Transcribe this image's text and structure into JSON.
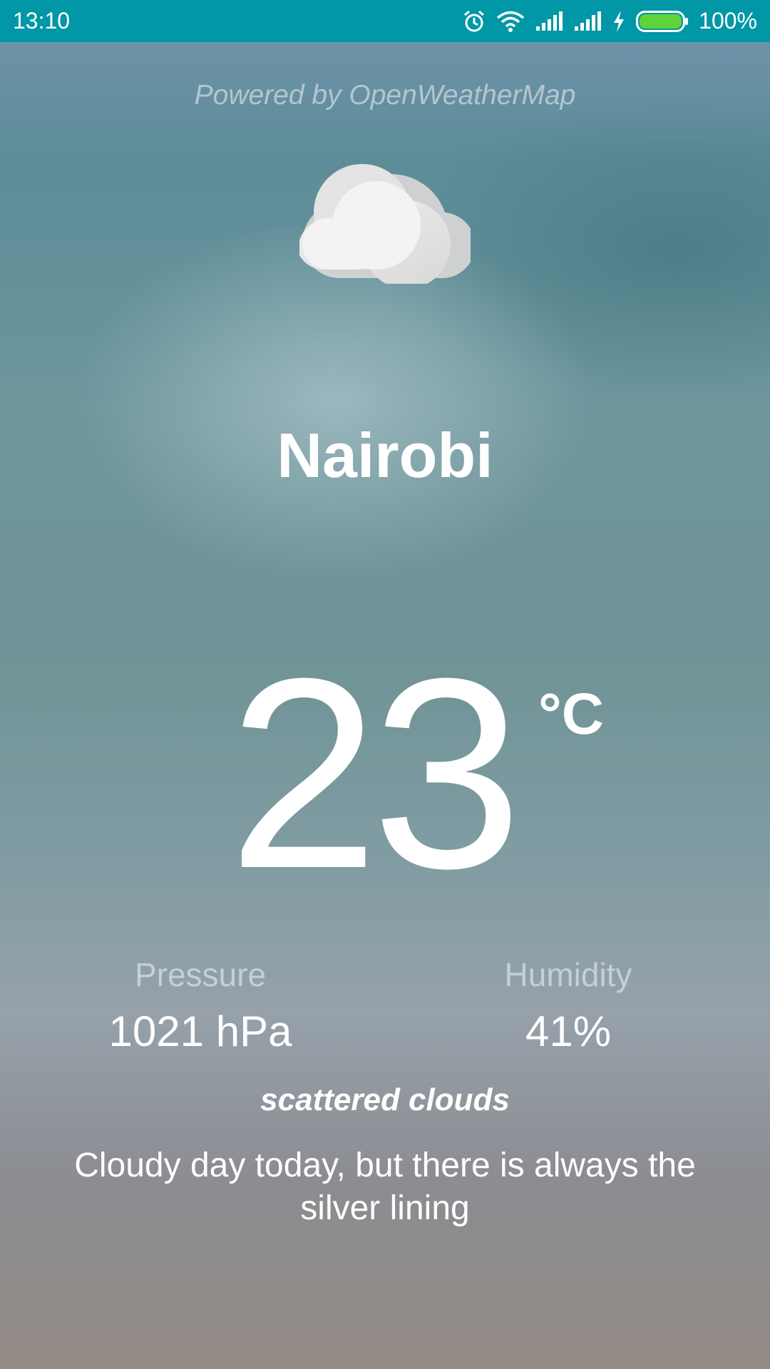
{
  "status_bar": {
    "time": "13:10",
    "battery_text": "100%",
    "battery_level": 1.0,
    "icons": [
      "alarm-icon",
      "wifi-icon",
      "signal-icon",
      "signal-icon",
      "charging-icon",
      "battery-icon"
    ],
    "background": "#0197a6"
  },
  "header": {
    "powered_by": "Powered by OpenWeatherMap"
  },
  "weather": {
    "icon": "cloud-icon",
    "city": "Nairobi",
    "temperature": "23",
    "unit": "°C",
    "pressure_label": "Pressure",
    "pressure_value": "1021 hPa",
    "humidity_label": "Humidity",
    "humidity_value": "41%",
    "description": "scattered clouds",
    "message": "Cloudy day today, but there is always the silver lining"
  }
}
